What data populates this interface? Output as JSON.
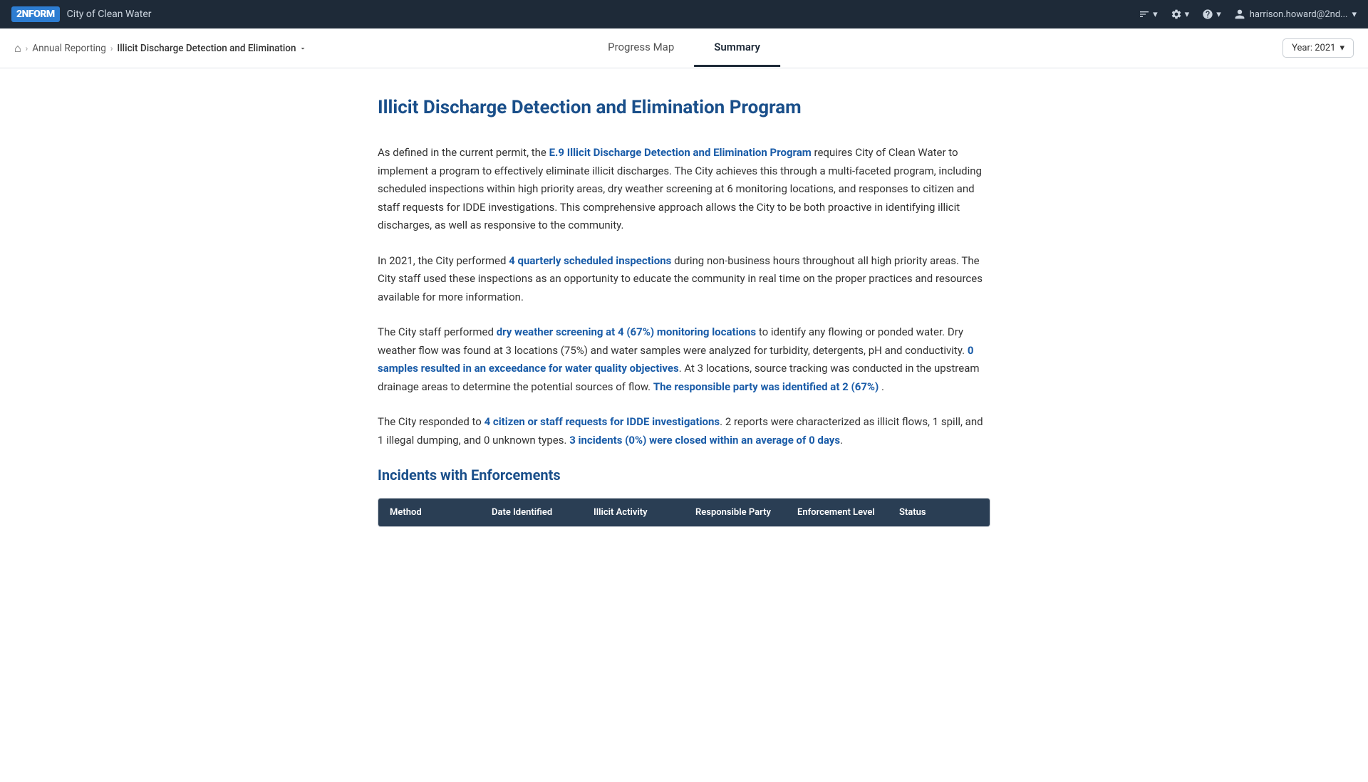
{
  "topbar": {
    "logo": "2N",
    "logo_label": "2NFORM",
    "app_title": "City of Clean Water",
    "icons": [
      {
        "name": "sort-icon",
        "label": "sort"
      },
      {
        "name": "settings-icon",
        "label": "settings"
      },
      {
        "name": "help-icon",
        "label": "help"
      }
    ],
    "user": "harrison.howard@2nd..."
  },
  "breadcrumb": {
    "home_label": "🏠",
    "items": [
      {
        "label": "Annual Reporting",
        "active": false
      },
      {
        "label": "Illicit Discharge Detection and Elimination",
        "active": true
      }
    ]
  },
  "tabs": [
    {
      "label": "Progress Map",
      "active": false
    },
    {
      "label": "Summary",
      "active": true
    }
  ],
  "year_selector": {
    "label": "Year: 2021"
  },
  "page": {
    "title": "Illicit Discharge Detection and Elimination Program",
    "paragraphs": [
      {
        "id": "intro",
        "plain_start": "As defined in the current permit, the ",
        "highlight1": "E.9 Illicit Discharge Detection and Elimination Program",
        "plain_end": " requires City of Clean Water to implement a program to effectively eliminate illicit discharges. The City achieves this through a multi-faceted program, including scheduled inspections within high priority areas, dry weather screening at 6 monitoring locations, and responses to citizen and staff requests for IDDE investigations. This comprehensive approach allows the City to be both proactive in identifying illicit discharges, as well as responsive to the community."
      },
      {
        "id": "quarterly",
        "plain_start": "In 2021, the City performed ",
        "highlight1": "4 quarterly scheduled inspections",
        "plain_end": " during non-business hours throughout all high priority areas. The City staff used these inspections as an opportunity to educate the community in real time on the proper practices and resources available for more information."
      },
      {
        "id": "dry-weather",
        "plain_start": "The City staff performed ",
        "highlight1": "dry weather screening at 4 (67%) monitoring locations",
        "plain_mid": " to identify any flowing or ponded water. Dry weather flow was found at 3 locations (75%) and water samples were analyzed for turbidity, detergents, pH and conductivity. ",
        "highlight2": "0 samples resulted in an exceedance for water quality objectives",
        "plain_end": ". At 3 locations, source tracking was conducted in the upstream drainage areas to determine the potential sources of flow. ",
        "highlight3": "The responsible party was identified at 2 (67%)",
        "plain_end2": " ."
      },
      {
        "id": "citizen",
        "plain_start": "The City responded to ",
        "highlight1": "4 citizen or staff requests for IDDE investigations",
        "plain_mid": ". 2 reports were characterized as illicit flows, 1 spill, and 1 illegal dumping, and 0 unknown types. ",
        "highlight2": "3 incidents (0%) were closed within an average of 0 days",
        "plain_end": "."
      }
    ],
    "incidents_section": {
      "heading": "Incidents with Enforcements",
      "table": {
        "columns": [
          "Method",
          "Date Identified",
          "Illicit Activity",
          "Responsible Party",
          "Enforcement Level",
          "Status"
        ]
      }
    }
  }
}
